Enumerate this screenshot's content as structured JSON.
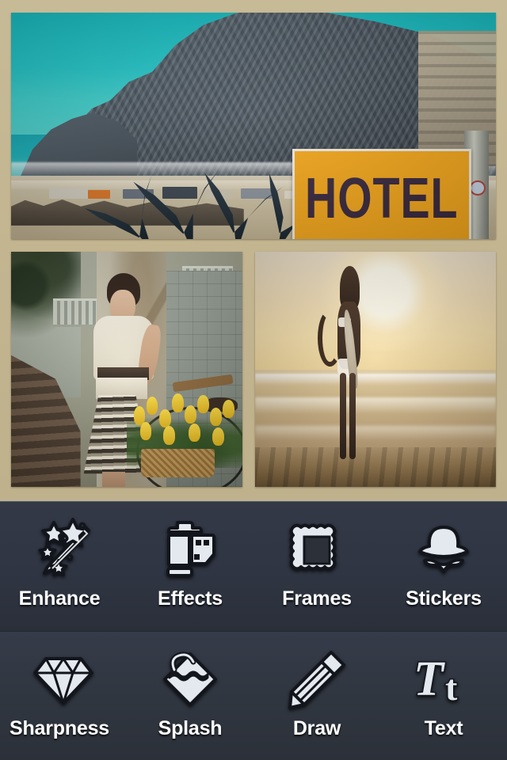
{
  "app": {
    "background_color": "#c4b793",
    "palette_color": "#2f3542",
    "label_color": "#ffffff",
    "icon_color": "#e8edf2"
  },
  "collage": {
    "name": "photo-collage-canvas",
    "layout": "one-top-two-bottom",
    "photos": [
      {
        "id": "photo-top",
        "name": "photo-coastal-bay-hotel",
        "description": "Coastal bay with rocky headland, turquoise sea, beach and a yellow HOTEL sign",
        "sign_text": "HOTEL",
        "sign_color": "#f5a81c",
        "sign_text_color": "#3a2a3f"
      },
      {
        "id": "photo-bottom-left",
        "name": "photo-vintage-fashion-tulips",
        "description": "Vintage styled woman in white blouse and striped skirt beside a bicycle with yellow tulips"
      },
      {
        "id": "photo-bottom-right",
        "name": "photo-surfer-sunset",
        "description": "Silhouette of a woman holding a surfboard on the beach at golden sunset"
      }
    ]
  },
  "toolbar": {
    "rows": [
      {
        "row": 1,
        "tools": [
          {
            "id": "enhance",
            "label": "Enhance",
            "icon": "magic-wand-icon"
          },
          {
            "id": "effects",
            "label": "Effects",
            "icon": "film-roll-icon"
          },
          {
            "id": "frames",
            "label": "Frames",
            "icon": "picture-frame-icon"
          },
          {
            "id": "stickers",
            "label": "Stickers",
            "icon": "hat-mustache-icon"
          }
        ]
      },
      {
        "row": 2,
        "tools": [
          {
            "id": "sharpness",
            "label": "Sharpness",
            "icon": "diamond-icon"
          },
          {
            "id": "splash",
            "label": "Splash",
            "icon": "paint-bucket-icon"
          },
          {
            "id": "draw",
            "label": "Draw",
            "icon": "pencil-icon"
          },
          {
            "id": "text",
            "label": "Text",
            "icon": "text-tt-icon"
          }
        ]
      }
    ]
  }
}
